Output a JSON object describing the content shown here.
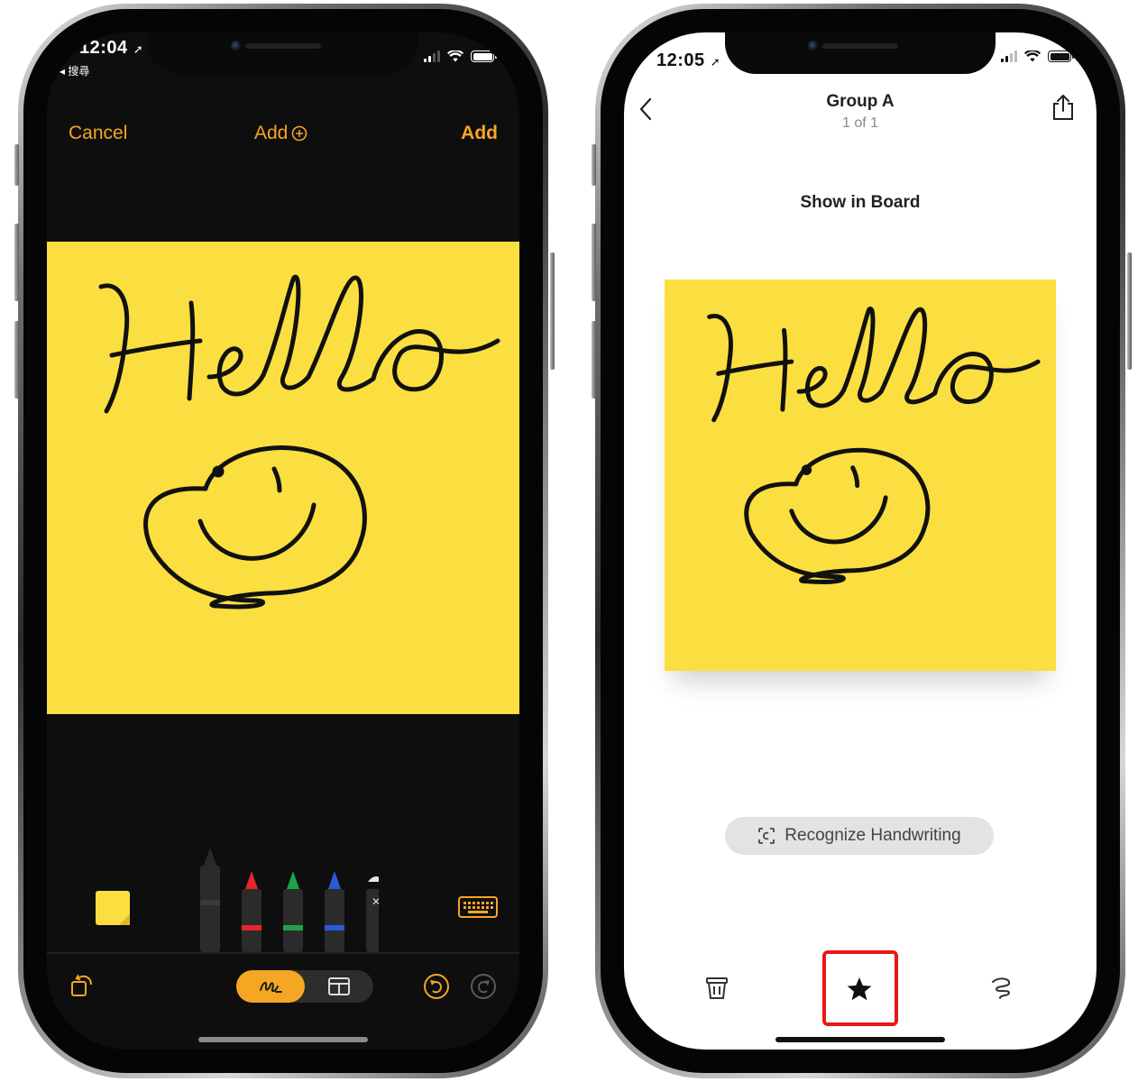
{
  "left_phone": {
    "status": {
      "time": "12:04",
      "back_label": "◂ 搜尋"
    },
    "nav": {
      "cancel": "Cancel",
      "title": "Add",
      "add": "Add"
    },
    "note": {
      "handwriting": "Hello",
      "color": "#fbdf40"
    },
    "toolbar": {
      "tools": [
        {
          "name": "pen",
          "band": "#3a3a3a"
        },
        {
          "name": "red-marker",
          "band": "#e5262d"
        },
        {
          "name": "green-marker",
          "band": "#1fa34a"
        },
        {
          "name": "blue-marker",
          "band": "#2a5bd7"
        },
        {
          "name": "eraser",
          "band": "#ffffff"
        }
      ],
      "accent": "#f5a623"
    }
  },
  "right_phone": {
    "status": {
      "time": "12:05"
    },
    "header": {
      "title": "Group A",
      "subtitle": "1 of 1"
    },
    "show_in_board": "Show in Board",
    "note": {
      "handwriting": "Hello",
      "color": "#fbdf40"
    },
    "recognize_label": "Recognize Handwriting",
    "bottom_bar": {
      "items": [
        "trash-icon",
        "star-icon",
        "lasso-icon"
      ],
      "highlight_color": "#e8161a"
    }
  }
}
